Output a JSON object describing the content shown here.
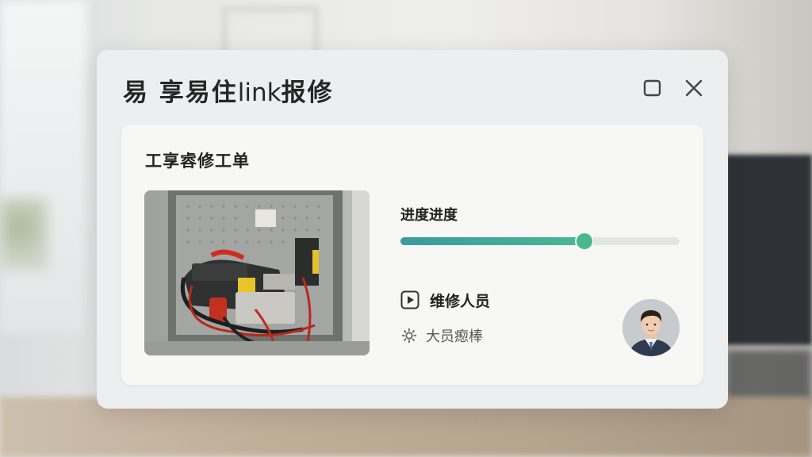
{
  "dialog": {
    "title_cn_1": "易 享易住",
    "title_latin": "link",
    "title_cn_2": "报修",
    "maximize_icon": "maximize-icon",
    "close_icon": "close-icon"
  },
  "card": {
    "title": "工享䜭修工单",
    "photo_subject": "electrical-panel-photo",
    "progress": {
      "label": "进度进度",
      "value": 0.66,
      "fill_gradient": [
        "#3a9aa0",
        "#49b892"
      ]
    },
    "technician": {
      "icon": "play-icon",
      "label": "维修人员"
    },
    "status": {
      "icon": "gear-icon",
      "text": "大员瘛棒"
    },
    "avatar": "technician-avatar"
  },
  "colors": {
    "accent": "#49b892",
    "accent_secondary": "#3a9aa0",
    "dialog_bg": "#eceeef",
    "card_bg": "#f7f7f6"
  }
}
